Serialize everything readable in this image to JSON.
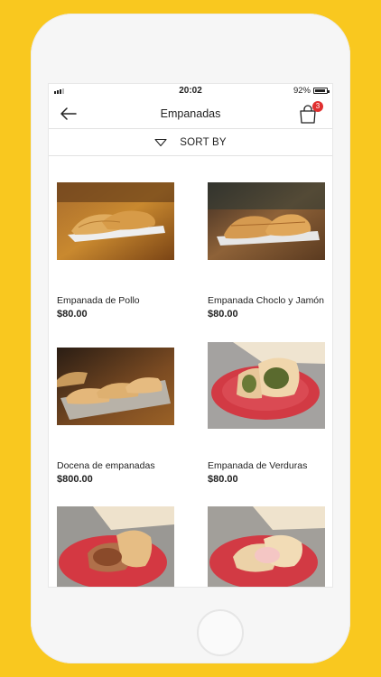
{
  "status_bar": {
    "time": "20:02",
    "battery": "92%"
  },
  "header": {
    "title": "Empanadas",
    "cart_count": "3",
    "back_icon": "arrow-left-icon",
    "cart_icon": "shopping-bag-icon"
  },
  "sort": {
    "label": "SORT BY",
    "icon": "triangle-down-icon"
  },
  "products": [
    {
      "name": "Empanada de Pollo",
      "price": "$80.00"
    },
    {
      "name": "Empanada Choclo y Jamón",
      "price": "$80.00"
    },
    {
      "name": "Docena de empanadas",
      "price": "$800.00"
    },
    {
      "name": "Empanada de Verduras",
      "price": "$80.00"
    },
    {
      "name": "",
      "price": ""
    },
    {
      "name": "",
      "price": ""
    }
  ],
  "colors": {
    "background": "#f9c81f",
    "badge": "#e02f2f",
    "text": "#222222"
  }
}
